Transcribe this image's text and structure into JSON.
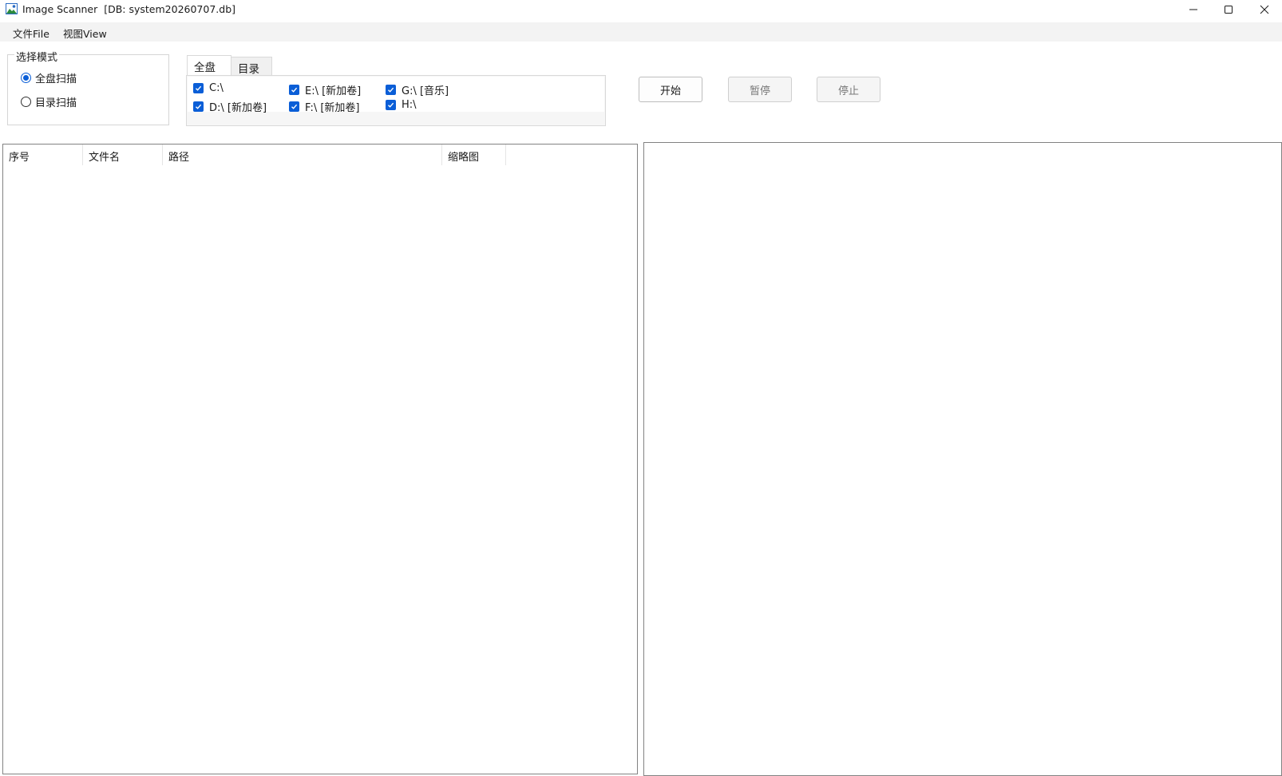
{
  "window": {
    "title": "Image Scanner  [DB: system20260707.db]",
    "controls": [
      "minimize-icon",
      "maximize-icon",
      "close-icon"
    ]
  },
  "menu": {
    "items": [
      {
        "label": "文件File"
      },
      {
        "label": "视图View"
      }
    ]
  },
  "mode_group": {
    "title": "选择模式",
    "options": [
      {
        "label": "全盘扫描",
        "selected": true
      },
      {
        "label": "目录扫描",
        "selected": false
      }
    ]
  },
  "tabs": {
    "items": [
      {
        "label": "全盘",
        "active": true
      },
      {
        "label": "目录",
        "active": false
      }
    ],
    "drives": [
      {
        "label": "C:\\",
        "checked": true
      },
      {
        "label": "E:\\ [新加卷]",
        "checked": true
      },
      {
        "label": "G:\\ [音乐]",
        "checked": true
      },
      {
        "label": "D:\\ [新加卷]",
        "checked": true
      },
      {
        "label": "F:\\ [新加卷]",
        "checked": true
      },
      {
        "label": "H:\\",
        "checked": true
      }
    ]
  },
  "actions": {
    "start": "开始",
    "pause": "暂停",
    "stop": "停止"
  },
  "table": {
    "columns": [
      "序号",
      "文件名",
      "路径",
      "缩略图"
    ],
    "rows": []
  },
  "colors": {
    "accent": "#0a5ed7",
    "border": "#828282",
    "menubar": "#f3f3f3"
  }
}
